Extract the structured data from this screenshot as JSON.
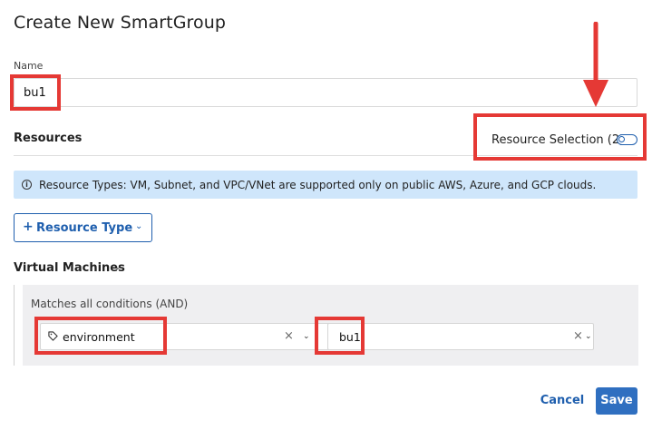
{
  "dialog": {
    "title": "Create New SmartGroup"
  },
  "name_field": {
    "label": "Name",
    "value": "bu1"
  },
  "resources": {
    "title": "Resources",
    "selection_label": "Resource Selection (2)",
    "toggle_on": false
  },
  "info_banner": {
    "text": "Resource Types: VM, Subnet, and VPC/VNet are supported only on public AWS, Azure, and GCP clouds."
  },
  "resource_type_button": {
    "plus": "+",
    "label": "Resource Type"
  },
  "virtual_machines": {
    "header": "Virtual Machines",
    "conditions_label": "Matches all conditions (AND)",
    "key_select": {
      "value": "environment",
      "icon": "tag-icon"
    },
    "value_select": {
      "value": "bu1"
    }
  },
  "footer": {
    "cancel_label": "Cancel",
    "save_label": "Save"
  },
  "colors": {
    "accent": "#1f5fae",
    "primary_button": "#2f6fc0",
    "banner_bg": "#cfe6fb",
    "highlight": "#e53935"
  }
}
